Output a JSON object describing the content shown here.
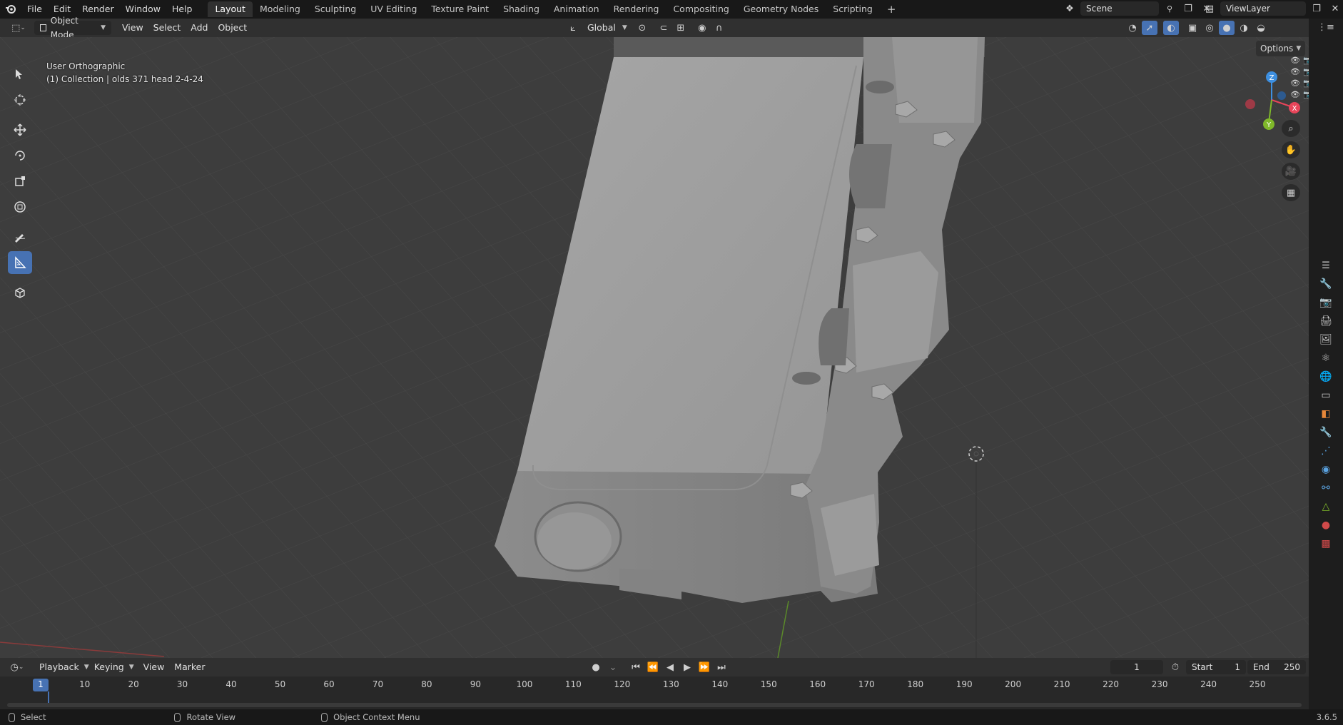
{
  "topbar": {
    "menus": [
      "File",
      "Edit",
      "Render",
      "Window",
      "Help"
    ],
    "workspaces": [
      "Layout",
      "Modeling",
      "Sculpting",
      "UV Editing",
      "Texture Paint",
      "Shading",
      "Animation",
      "Rendering",
      "Compositing",
      "Geometry Nodes",
      "Scripting"
    ],
    "active_workspace": "Layout",
    "scene": "Scene",
    "view_layer": "ViewLayer"
  },
  "header": {
    "mode": "Object Mode",
    "menus": [
      "View",
      "Select",
      "Add",
      "Object"
    ],
    "transform_orientation": "Global",
    "options": "Options"
  },
  "viewport": {
    "view_name": "User Orthographic",
    "collection_info": "(1) Collection | olds 371 head 2-4-24",
    "gizmo_axes": {
      "x": "X",
      "y": "Y",
      "z": "Z"
    }
  },
  "timeline": {
    "menus": [
      "Playback",
      "Keying",
      "View",
      "Marker"
    ],
    "current_frame": "1",
    "start_label": "Start",
    "start_value": "1",
    "end_label": "End",
    "end_value": "250",
    "ticks": [
      "1",
      "10",
      "20",
      "30",
      "40",
      "50",
      "60",
      "70",
      "80",
      "90",
      "100",
      "110",
      "120",
      "130",
      "140",
      "150",
      "160",
      "170",
      "180",
      "190",
      "200",
      "210",
      "220",
      "230",
      "240",
      "250"
    ]
  },
  "statusbar": {
    "select": "Select",
    "rotate": "Rotate View",
    "context": "Object Context Menu",
    "version": "3.6.5"
  },
  "colors": {
    "accent": "#4772b3",
    "x_axis": "#e8455a",
    "y_axis": "#7fb82a",
    "z_axis": "#3d8fe0"
  }
}
